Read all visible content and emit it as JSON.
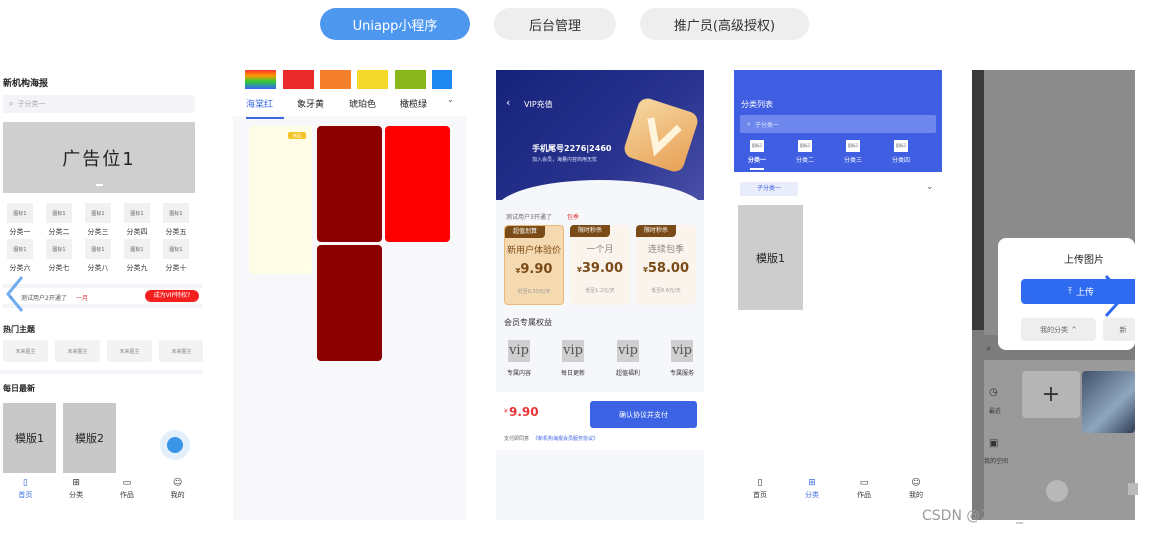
{
  "tabs": [
    {
      "label": "Uniapp小程序",
      "active": true
    },
    {
      "label": "后台管理",
      "active": false
    },
    {
      "label": "推广员(高级授权)",
      "active": false
    }
  ],
  "screen1": {
    "title": "新机构海报",
    "search_placeholder": "子分类一",
    "banner_text": "广告位1",
    "icon_label": "图标1",
    "categories": [
      "分类一",
      "分类二",
      "分类三",
      "分类四",
      "分类五",
      "分类六",
      "分类七",
      "分类八",
      "分类九",
      "分类十"
    ],
    "notice": "测试用户2开通了",
    "notice_highlight": "一月",
    "vip_button": "成为VIP特权?",
    "hot_title": "热门主题",
    "hot_items": [
      "未来图主",
      "未来图主",
      "未来图主",
      "未来图主"
    ],
    "daily_title": "每日最新",
    "templates": [
      "模版1",
      "模版2"
    ],
    "tabbar": [
      "首页",
      "分类",
      "作品",
      "我的"
    ]
  },
  "screen2": {
    "color_tabs": [
      "海棠红",
      "象牙黄",
      "琥珀色",
      "橄榄绿"
    ],
    "swatches": [
      "#e83b3b",
      "#ea2a2a",
      "#f47f2a",
      "#f5d92a",
      "#8ab81c",
      "#1e88f0"
    ],
    "badge": "新品",
    "block_colors": [
      "#fffde6",
      "#8b0000",
      "#ff0000",
      "#8b0000"
    ]
  },
  "screen3": {
    "title": "VIP充值",
    "phone": "手机尾号2276|2460",
    "phone_sub": "加入会员，海量内容商用无忧",
    "notice": "测试用户3开通了",
    "notice_highlight": "包季",
    "cards": [
      {
        "badge": "超值划算",
        "name": "新用户体验价",
        "price": "9.90",
        "sub": "低至0.33元/天"
      },
      {
        "badge": "限时秒杀",
        "name": "一个月",
        "price": "39.00",
        "sub": "低至1.2元/天"
      },
      {
        "badge": "限时秒杀",
        "name": "连续包季",
        "price": "58.00",
        "sub": "低至0.6元/天"
      }
    ],
    "benefits_title": "会员专属权益",
    "benefit_icon": "vip",
    "benefits": [
      "专属内容",
      "每日更新",
      "超值福利",
      "专属服务"
    ],
    "total": "9.90",
    "currency": "¥",
    "pay_button": "确认协议并支付",
    "agreement": "支付即同意",
    "agreement_link": "《新机构海报会员服务协议》"
  },
  "screen4": {
    "title": "分类列表",
    "search_placeholder": "子分类一",
    "icon_label": "图标1",
    "categories": [
      "分类一",
      "分类二",
      "分类三",
      "分类四"
    ],
    "sub_tab": "子分类一",
    "template": "模版1",
    "tabbar": [
      "首页",
      "分类",
      "作品",
      "我的"
    ]
  },
  "screen5": {
    "dialog_title": "上传图片",
    "upload_button": "上传",
    "my_category": "我的分类",
    "new_partial": "新",
    "side_items": [
      "最近",
      "我的空间"
    ]
  },
  "watermark": "CSDN @2401_84413757"
}
